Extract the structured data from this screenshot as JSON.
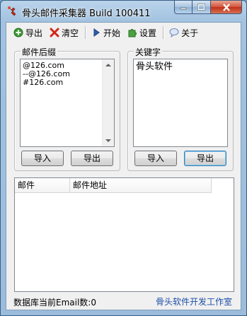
{
  "window": {
    "title": "骨头邮件采集器 Build 100411"
  },
  "toolbar": {
    "export_label": "导出",
    "clear_label": "清空",
    "start_label": "开始",
    "settings_label": "设置",
    "about_label": "关于"
  },
  "suffix_group": {
    "label": "邮件后缀",
    "lines": [
      "@126.com",
      "--@126.com",
      "#126.com"
    ],
    "import_label": "导入",
    "export_label": "导出"
  },
  "keyword_group": {
    "label": "关键字",
    "text": "骨头软件",
    "import_label": "导入",
    "export_label": "导出"
  },
  "results": {
    "columns": [
      "邮件",
      "邮件地址"
    ]
  },
  "status": {
    "count_text": "数据库当前Email数:0",
    "studio_link": "骨头软件开发工作室"
  },
  "colors": {
    "link": "#1c4fa8",
    "close_button": "#c0301a"
  },
  "icons": {
    "app": "bone-app-icon",
    "export": "green-plus-icon",
    "clear": "red-x-icon",
    "start": "play-triangle-icon",
    "settings": "puzzle-gear-icon",
    "about": "speech-bubble-icon"
  }
}
